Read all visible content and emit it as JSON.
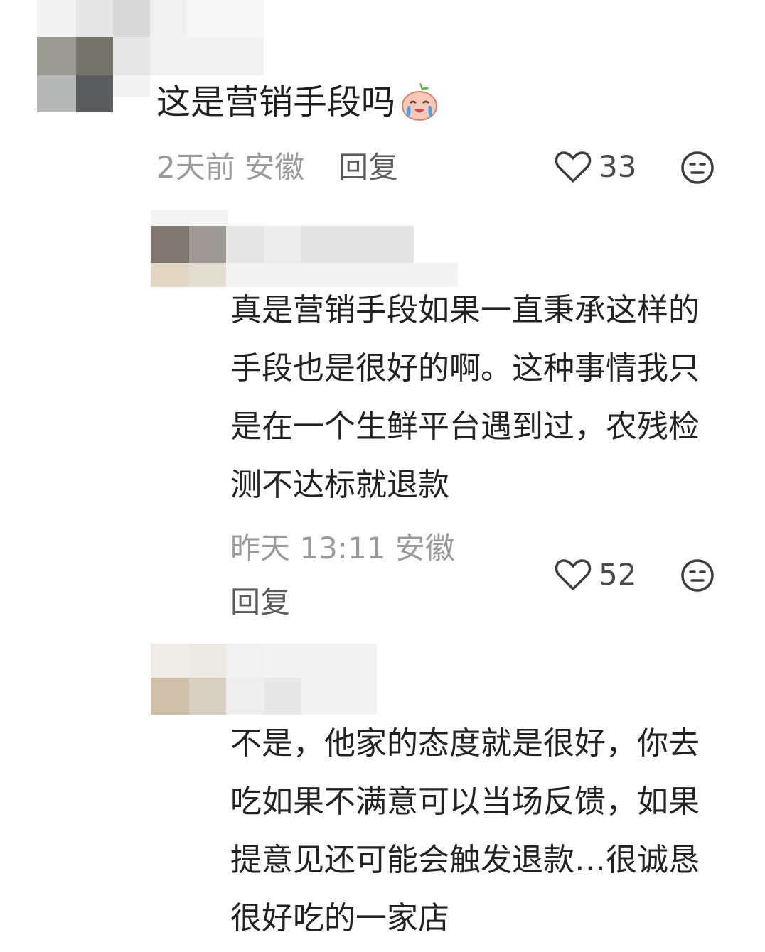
{
  "comments": [
    {
      "text": "这是营销手段吗",
      "emoji": "crying-face-emoji",
      "time": "2天前",
      "location": "安徽",
      "reply_label": "回复",
      "likes": "33"
    }
  ],
  "replies": [
    {
      "text": "真是营销手段如果一直秉承这样的手段也是很好的啊。这种事情我只是在一个生鲜平台遇到过，农残检测不达标就退款",
      "time": "昨天 13:11",
      "location": "安徽",
      "reply_label": "回复",
      "likes": "52"
    },
    {
      "text": "不是，他家的态度就是很好，你去吃如果不满意可以当场反馈，如果提意见还可能会触发退款…很诚恳很好吃的一家店"
    }
  ],
  "icons": {
    "like": "heart-outline-icon",
    "dislike": "neutral-face-icon"
  }
}
